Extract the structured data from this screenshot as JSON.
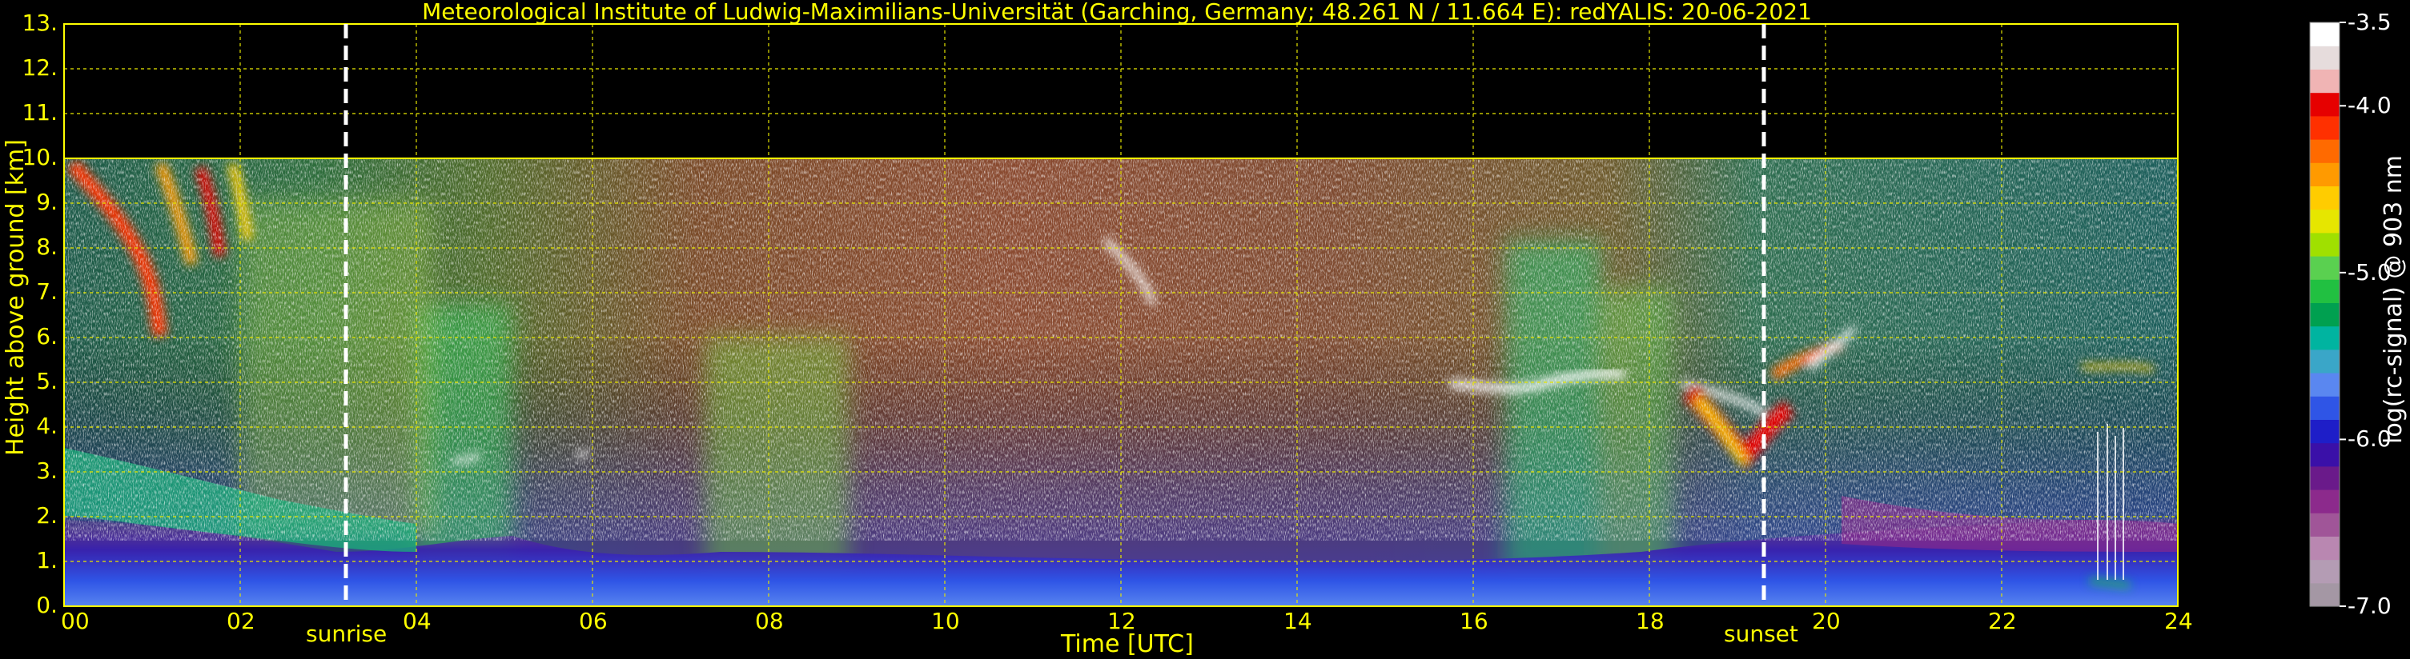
{
  "chart_data": {
    "type": "heatmap",
    "title": "Meteorological Institute of Ludwig-Maximilians-Universität (Garching, Germany; 48.261 N / 11.664 E):    redYALIS: 20-06-2021",
    "xlabel": "Time [UTC]",
    "ylabel": "Height above ground [km]",
    "xlim": [
      0,
      24
    ],
    "ylim": [
      0,
      13
    ],
    "x_ticks": [
      "00",
      "02",
      "04",
      "06",
      "08",
      "10",
      "12",
      "14",
      "16",
      "18",
      "20",
      "22",
      "24"
    ],
    "y_ticks": [
      "0.",
      "1.",
      "2.",
      "3.",
      "4.",
      "5.",
      "6.",
      "7.",
      "8.",
      "9.",
      "10.",
      "11.",
      "12.",
      "13."
    ],
    "grid": true,
    "data_top_km": 10,
    "annotations": [
      {
        "label": "sunrise",
        "time_utc": 3.2
      },
      {
        "label": "sunset",
        "time_utc": 19.3
      }
    ],
    "colorbar": {
      "label": "log(rc-signal) @ 903 nm",
      "range": [
        -7.0,
        -3.5
      ],
      "ticks": [
        "-3.5",
        "-4.0",
        "-5.0",
        "-6.0",
        "-7.0"
      ],
      "tick_values": [
        -3.5,
        -4.0,
        -5.0,
        -6.0,
        -7.0
      ],
      "colors": [
        "#a497a4",
        "#b49cb4",
        "#b987b1",
        "#a05598",
        "#8c2a8c",
        "#6a1a8a",
        "#3a10a8",
        "#1e1ec8",
        "#2f55e6",
        "#5a87f0",
        "#3aa6c8",
        "#00b4a0",
        "#00a050",
        "#21c041",
        "#5ad050",
        "#a0e000",
        "#e6e600",
        "#ffcc00",
        "#ff9a00",
        "#ff6a00",
        "#ff3000",
        "#e60000",
        "#f0b4b4",
        "#e6dcdc",
        "#ffffff"
      ]
    },
    "features": [
      {
        "name": "boundary-layer",
        "region_km": [
          0,
          2
        ]
      },
      {
        "name": "cirrus",
        "time_utc": [
          0,
          2.5
        ],
        "height_km": [
          6,
          10
        ]
      },
      {
        "name": "elevated-layer",
        "time_utc": [
          15.5,
          16.9
        ],
        "height_km": [
          4.6,
          5.3
        ]
      },
      {
        "name": "cloud",
        "time_utc": [
          18.3,
          19.7
        ],
        "height_km": [
          3.5,
          6
        ]
      }
    ]
  }
}
